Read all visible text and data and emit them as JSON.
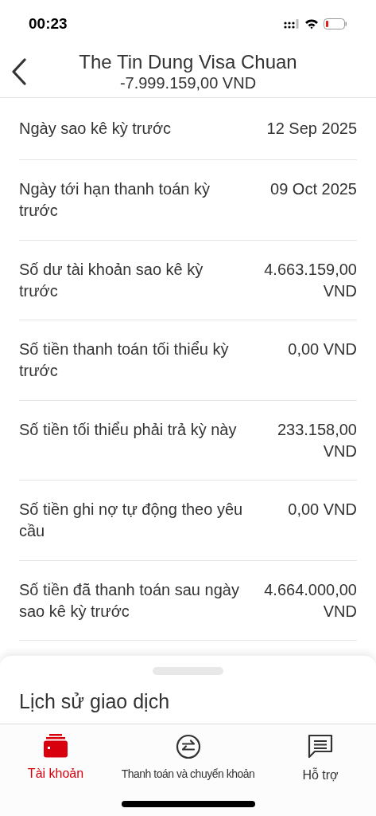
{
  "status_bar": {
    "time": "00:23"
  },
  "header": {
    "title": "The Tin Dung Visa Chuan",
    "subtitle": "-7.999.159,00 VND"
  },
  "rows": [
    {
      "label": "Ngày sao kê kỳ trước",
      "value": "12 Sep 2025"
    },
    {
      "label": "Ngày tới hạn thanh toán kỳ trước",
      "value": "09 Oct 2025"
    },
    {
      "label": "Số dư tài khoản sao kê kỳ trước",
      "value": "4.663.159,00 VND"
    },
    {
      "label": "Số tiền thanh toán tối thiểu kỳ trước",
      "value": "0,00 VND"
    },
    {
      "label": "Số tiền tối thiểu phải trả kỳ này",
      "value": "233.158,00 VND"
    },
    {
      "label": "Số tiền ghi nợ tự động theo yêu cầu",
      "value": "0,00 VND"
    },
    {
      "label": "Số tiền đã thanh toán sau ngày sao kê kỳ trước",
      "value": "4.664.000,00 VND"
    }
  ],
  "sheet": {
    "title": "Lịch sử giao dịch"
  },
  "tabs": [
    {
      "kind": "account",
      "label": "Tài khoản",
      "selected": true
    },
    {
      "kind": "transfer",
      "label": "Thanh toán và chuyển khoản",
      "selected": false
    },
    {
      "kind": "support",
      "label": "Hỗ trợ",
      "selected": false
    }
  ]
}
